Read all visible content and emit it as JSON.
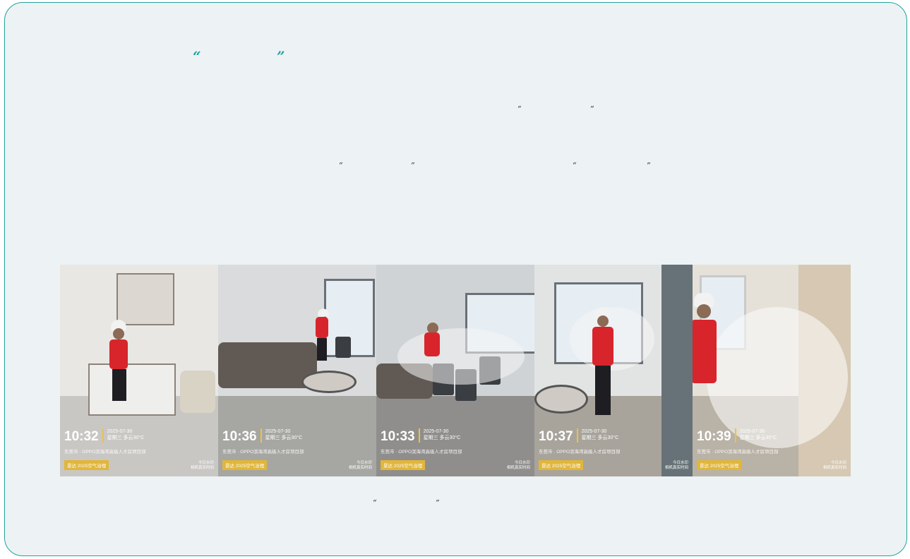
{
  "quotes": {
    "title_open": "“",
    "title_close": "”",
    "line1_open": "“",
    "line1_close": "”",
    "line2a_open": "“",
    "line2a_close": "”",
    "line2b_open": "“",
    "line2b_close": "”",
    "caption_open": "“",
    "caption_close": "”"
  },
  "colors": {
    "accent": "#1fa39a",
    "card_bg": "#edf2f4",
    "badge": "#e1b63a",
    "shirt": "#d8252c"
  },
  "photos": [
    {
      "time": "10:32",
      "date": "2025-07-30",
      "weather": "星期三 多云30°C",
      "location": "东莞市 · OPPO滨海湾高级人才房项目部",
      "badge": "景达 2025空气治理",
      "watermark": "今日水印\n相机真实时间"
    },
    {
      "time": "10:36",
      "date": "2025-07-30",
      "weather": "星期三 多云30°C",
      "location": "东莞市 · OPPO滨海湾高级人才房项目部",
      "badge": "景达 2025空气治理",
      "watermark": "今日水印\n相机真实时间"
    },
    {
      "time": "10:33",
      "date": "2025-07-30",
      "weather": "星期三 多云30°C",
      "location": "东莞市 · OPPO滨海湾高级人才房项目部",
      "badge": "景达 2025空气治理",
      "watermark": "今日水印\n相机真实时间"
    },
    {
      "time": "10:37",
      "date": "2025-07-30",
      "weather": "星期三 多云30°C",
      "location": "东莞市 · OPPO滨海湾高级人才房项目部",
      "badge": "景达 2025空气治理",
      "watermark": "今日水印\n相机真实时间"
    },
    {
      "time": "10:39",
      "date": "2025-07-30",
      "weather": "星期三 多云30°C",
      "location": "东莞市 · OPPO滨海湾高级人才房项目部",
      "badge": "景达 2025空气治理",
      "watermark": "今日水印\n相机真实时间"
    }
  ]
}
